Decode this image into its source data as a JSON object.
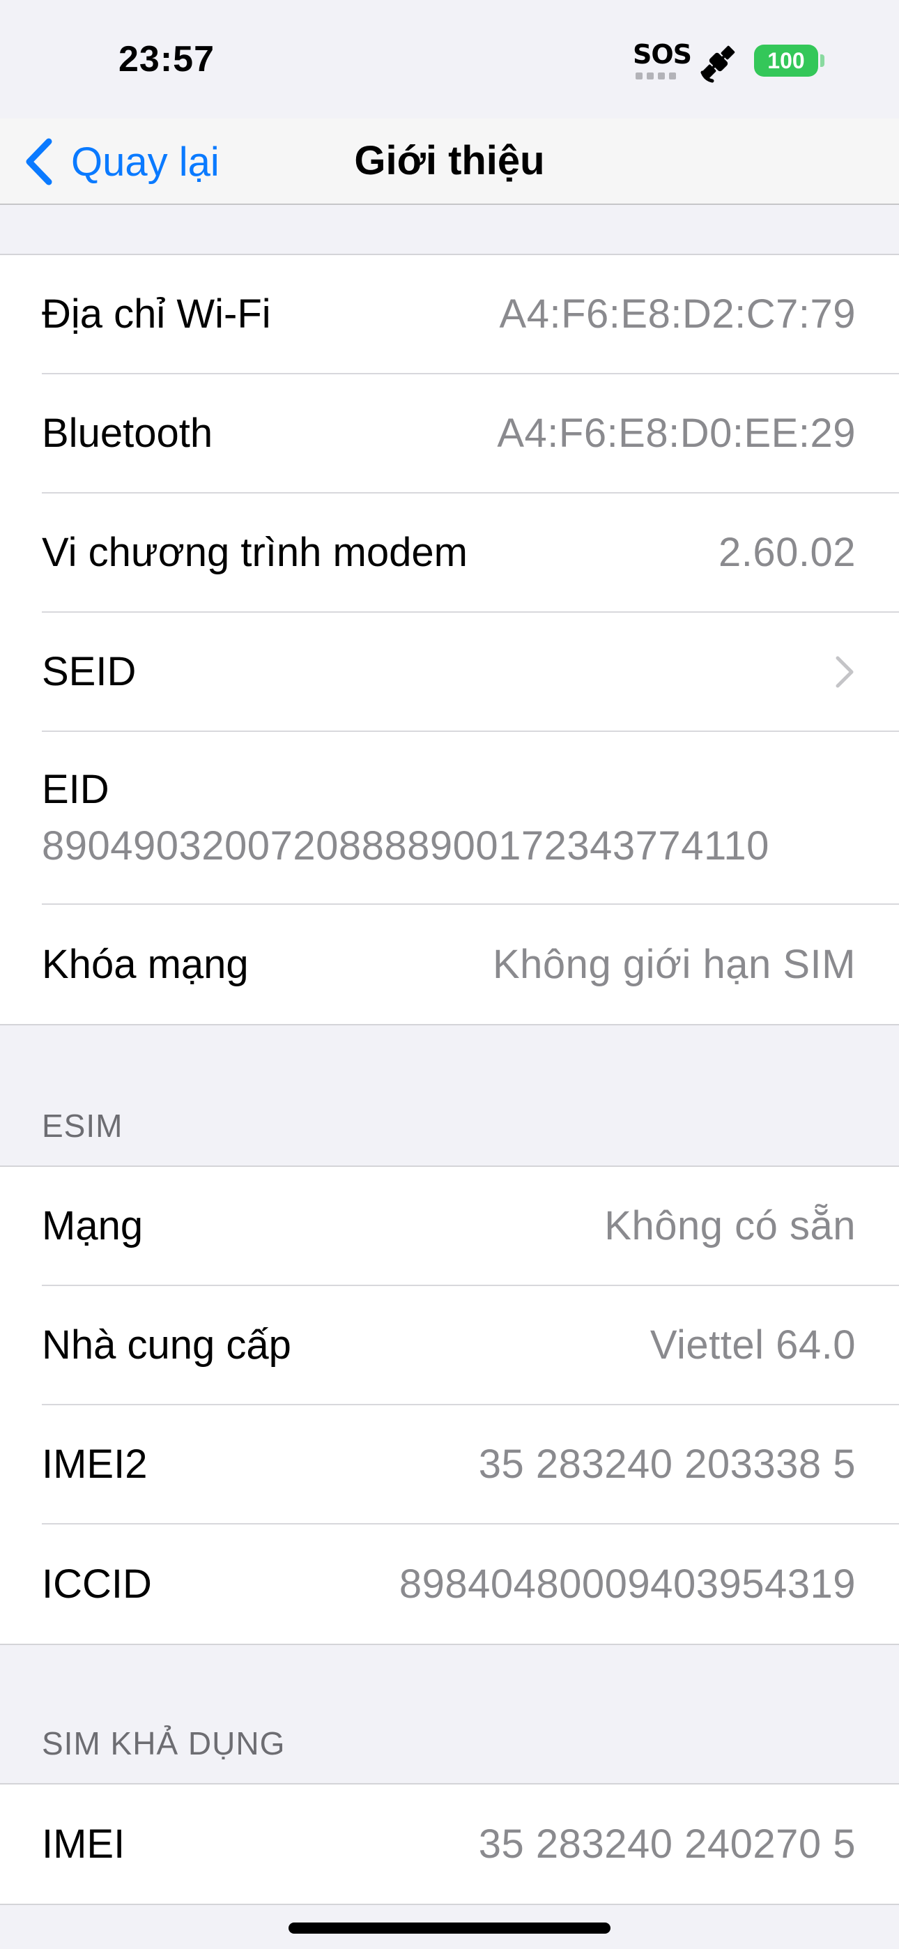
{
  "status_bar": {
    "time": "23:57",
    "sos": "SOS",
    "battery": "100",
    "battery_color": "#34c759",
    "icons": [
      "satellite-icon",
      "battery-icon"
    ]
  },
  "nav": {
    "back_label": "Quay lại",
    "title": "Giới thiệu",
    "accent_color": "#0a7aff",
    "icons": [
      "chevron-left-icon"
    ]
  },
  "group1": {
    "rows": [
      {
        "label": "Địa chỉ Wi-Fi",
        "value": "A4:F6:E8:D2:C7:79"
      },
      {
        "label": "Bluetooth",
        "value": "A4:F6:E8:D0:EE:29"
      },
      {
        "label": "Vi chương trình modem",
        "value": "2.60.02"
      },
      {
        "label": "SEID",
        "icon": "chevron-right-icon"
      },
      {
        "label": "EID",
        "value": "89049032007208888900172343774110"
      },
      {
        "label": "Khóa mạng",
        "value": "Không giới hạn SIM"
      }
    ]
  },
  "esim": {
    "header": "ESIM",
    "rows": [
      {
        "label": "Mạng",
        "value": "Không có sẵn"
      },
      {
        "label": "Nhà cung cấp",
        "value": "Viettel 64.0"
      },
      {
        "label": "IMEI2",
        "value": "35 283240 203338 5"
      },
      {
        "label": "ICCID",
        "value": "8984048000940395431​9"
      }
    ]
  },
  "sim_available": {
    "header": "SIM KHẢ DỤNG",
    "rows": [
      {
        "label": "IMEI",
        "value": "35 283240 240270 5"
      }
    ]
  }
}
